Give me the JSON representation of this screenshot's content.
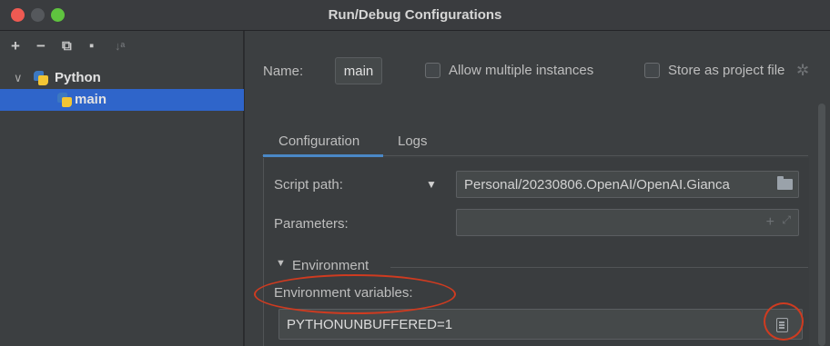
{
  "window": {
    "title": "Run/Debug Configurations"
  },
  "sidebar": {
    "toolbar": [
      {
        "name": "add-icon",
        "glyph": "+"
      },
      {
        "name": "remove-icon",
        "glyph": "−"
      },
      {
        "name": "copy-icon",
        "glyph": "⧉"
      },
      {
        "name": "move-to-folder-icon",
        "glyph": "▪"
      },
      {
        "name": "sort-icon",
        "glyph": "↓ᵃ"
      }
    ],
    "tree": [
      {
        "label": "Python",
        "expanded": true
      },
      {
        "label": "main",
        "selected": true
      }
    ]
  },
  "form": {
    "name_label": "Name:",
    "name_value": "main",
    "allow_multiple_label": "Allow multiple instances",
    "store_project_label": "Store as project file",
    "tabs": [
      {
        "label": "Configuration",
        "active": true
      },
      {
        "label": "Logs",
        "active": false
      }
    ],
    "script_path_label": "Script path:",
    "script_path_value": "Personal/20230806.OpenAI/OpenAI.Gianca",
    "parameters_label": "Parameters:",
    "parameters_value": "",
    "environment_section": "Environment",
    "env_vars_label": "Environment variables:",
    "env_vars_value": "PYTHONUNBUFFERED=1"
  },
  "colors": {
    "accent": "#2f65ca",
    "annotation": "#cf3b20"
  }
}
